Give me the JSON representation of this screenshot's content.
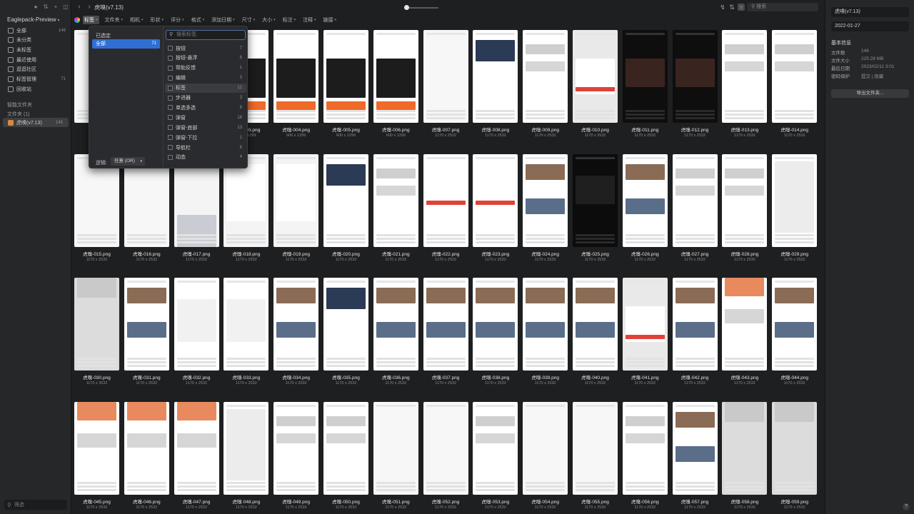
{
  "sidebar": {
    "library_title": "Eaglepack-Preview",
    "items": [
      {
        "label": "全部",
        "count": "146"
      },
      {
        "label": "未分类",
        "count": ""
      },
      {
        "label": "未标签",
        "count": ""
      },
      {
        "label": "最近使用",
        "count": ""
      },
      {
        "label": "逛逛社区",
        "count": ""
      },
      {
        "label": "标签管理",
        "count": "71"
      },
      {
        "label": "回收站",
        "count": ""
      }
    ],
    "smart_folders_label": "智能文件夹",
    "folders_label": "文件夹 (1)",
    "active_folder": {
      "label": "虎嗅(v7.13)",
      "count": "146"
    },
    "filter_placeholder": "筛选"
  },
  "toolbar": {
    "folder_title": "虎嗅(v7.13)",
    "search_placeholder": "搜索"
  },
  "filterbar": {
    "items": [
      "标签",
      "文件夹",
      "相机",
      "形状",
      "评分",
      "格式",
      "添加日期",
      "尺寸",
      "大小",
      "标注",
      "注释",
      "链接"
    ]
  },
  "tag_panel": {
    "selected_label": "已选定",
    "all_label": "全部",
    "all_count": "71",
    "search_placeholder": "搜索标签",
    "tags": [
      {
        "label": "按钮",
        "count": "7"
      },
      {
        "label": "按钮-悬浮",
        "count": "6"
      },
      {
        "label": "帮助反馈",
        "count": "1"
      },
      {
        "label": "编辑",
        "count": "3"
      },
      {
        "label": "标签",
        "count": "11"
      },
      {
        "label": "步进器",
        "count": "3"
      },
      {
        "label": "单选多选",
        "count": "8"
      },
      {
        "label": "弹窗",
        "count": "18"
      },
      {
        "label": "弹窗-底部",
        "count": "13"
      },
      {
        "label": "弹窗-下拉",
        "count": "1"
      },
      {
        "label": "导航栏",
        "count": "8"
      },
      {
        "label": "动态",
        "count": "4"
      }
    ],
    "logic_label": "逻辑:",
    "logic_value": "任意 (OR)"
  },
  "inspector": {
    "name_value": "虎嗅(v7.13)",
    "date_value": "2022-01-27",
    "heading": "基本信息",
    "rows": [
      {
        "label": "文件数",
        "value": "146"
      },
      {
        "label": "文件大小",
        "value": "225.28 MB"
      },
      {
        "label": "最后日期",
        "value": "2023/02/11 3:01"
      },
      {
        "label": "密码保护",
        "value": "提交 | 隐藏"
      }
    ],
    "export_label": "导出文件夹..."
  },
  "grid": {
    "items": [
      {
        "name": "",
        "dims": "",
        "theme": "white"
      },
      {
        "name": "",
        "dims": "",
        "theme": "white"
      },
      {
        "name": "虎嗅-003.png",
        "dims": "600 x 1299",
        "theme": "promo"
      },
      {
        "name": "虎嗅-003.png",
        "dims": "600 x 1299",
        "theme": "promo"
      },
      {
        "name": "虎嗅-004.png",
        "dims": "600 x 1299",
        "theme": "promo"
      },
      {
        "name": "虎嗅-005.png",
        "dims": "600 x 1299",
        "theme": "promo"
      },
      {
        "name": "虎嗅-006.png",
        "dims": "600 x 1299",
        "theme": "promo"
      },
      {
        "name": "虎嗅-007.png",
        "dims": "1170 x 2532",
        "theme": "white"
      },
      {
        "name": "虎嗅-008.png",
        "dims": "1170 x 2532",
        "theme": "article"
      },
      {
        "name": "虎嗅-009.png",
        "dims": "1170 x 2532",
        "theme": "list"
      },
      {
        "name": "虎嗅-010.png",
        "dims": "1170 x 2532",
        "theme": "modal"
      },
      {
        "name": "虎嗅-011.png",
        "dims": "1170 x 2532",
        "theme": "dark"
      },
      {
        "name": "虎嗅-012.png",
        "dims": "1170 x 2532",
        "theme": "dark"
      },
      {
        "name": "虎嗅-013.png",
        "dims": "1170 x 2532",
        "theme": "list"
      },
      {
        "name": "虎嗅-014.png",
        "dims": "1170 x 2532",
        "theme": "list"
      },
      {
        "name": "虎嗅-015.png",
        "dims": "1170 x 2532",
        "theme": "white"
      },
      {
        "name": "虎嗅-016.png",
        "dims": "1170 x 2532",
        "theme": "white"
      },
      {
        "name": "虎嗅-017.png",
        "dims": "1170 x 2532",
        "theme": "keyboard"
      },
      {
        "name": "虎嗅-018.png",
        "dims": "1170 x 2532",
        "theme": "settings"
      },
      {
        "name": "虎嗅-019.png",
        "dims": "1170 x 2532",
        "theme": "settings"
      },
      {
        "name": "虎嗅-020.png",
        "dims": "1170 x 2532",
        "theme": "article"
      },
      {
        "name": "虎嗅-021.png",
        "dims": "1170 x 2532",
        "theme": "list"
      },
      {
        "name": "虎嗅-022.png",
        "dims": "1170 x 2532",
        "theme": "form"
      },
      {
        "name": "虎嗅-023.png",
        "dims": "1170 x 2532",
        "theme": "form"
      },
      {
        "name": "虎嗅-024.png",
        "dims": "1170 x 2532",
        "theme": "feed"
      },
      {
        "name": "虎嗅-025.png",
        "dims": "1170 x 2532",
        "theme": "video"
      },
      {
        "name": "虎嗅-026.png",
        "dims": "1170 x 2532",
        "theme": "feed"
      },
      {
        "name": "虎嗅-027.png",
        "dims": "1170 x 2532",
        "theme": "list"
      },
      {
        "name": "虎嗅-028.png",
        "dims": "1170 x 2532",
        "theme": "list"
      },
      {
        "name": "虎嗅-029.png",
        "dims": "1170 x 2532",
        "theme": "text"
      },
      {
        "name": "虎嗅-030.png",
        "dims": "1170 x 2532",
        "theme": "grey"
      },
      {
        "name": "虎嗅-031.png",
        "dims": "1170 x 2532",
        "theme": "feed"
      },
      {
        "name": "虎嗅-032.png",
        "dims": "1170 x 2532",
        "theme": "calendar"
      },
      {
        "name": "虎嗅-033.png",
        "dims": "1170 x 2532",
        "theme": "calendar"
      },
      {
        "name": "虎嗅-034.png",
        "dims": "1170 x 2532",
        "theme": "feed"
      },
      {
        "name": "虎嗅-035.png",
        "dims": "1170 x 2532",
        "theme": "article"
      },
      {
        "name": "虎嗅-036.png",
        "dims": "1170 x 2532",
        "theme": "feed"
      },
      {
        "name": "虎嗅-037.png",
        "dims": "1170 x 2532",
        "theme": "feed"
      },
      {
        "name": "虎嗅-038.png",
        "dims": "1170 x 2532",
        "theme": "feed"
      },
      {
        "name": "虎嗅-039.png",
        "dims": "1170 x 2532",
        "theme": "feed"
      },
      {
        "name": "虎嗅-040.png",
        "dims": "1170 x 2532",
        "theme": "feed"
      },
      {
        "name": "虎嗅-041.png",
        "dims": "1170 x 2532",
        "theme": "modal"
      },
      {
        "name": "虎嗅-042.png",
        "dims": "1170 x 2532",
        "theme": "feed"
      },
      {
        "name": "虎嗅-043.png",
        "dims": "1170 x 2532",
        "theme": "orange"
      },
      {
        "name": "虎嗅-044.png",
        "dims": "1170 x 2532",
        "theme": "feed"
      },
      {
        "name": "虎嗅-045.png",
        "dims": "1170 x 2532",
        "theme": "orange"
      },
      {
        "name": "虎嗅-046.png",
        "dims": "1170 x 2532",
        "theme": "orange"
      },
      {
        "name": "虎嗅-047.png",
        "dims": "1170 x 2532",
        "theme": "orange"
      },
      {
        "name": "虎嗅-048.png",
        "dims": "1170 x 2532",
        "theme": "text"
      },
      {
        "name": "虎嗅-049.png",
        "dims": "1170 x 2532",
        "theme": "list"
      },
      {
        "name": "虎嗅-050.png",
        "dims": "1170 x 2532",
        "theme": "list"
      },
      {
        "name": "虎嗅-051.png",
        "dims": "1170 x 2532",
        "theme": "white"
      },
      {
        "name": "虎嗅-052.png",
        "dims": "1170 x 2532",
        "theme": "white"
      },
      {
        "name": "虎嗅-053.png",
        "dims": "1170 x 2532",
        "theme": "list"
      },
      {
        "name": "虎嗅-054.png",
        "dims": "1170 x 2532",
        "theme": "white"
      },
      {
        "name": "虎嗅-055.png",
        "dims": "1170 x 2532",
        "theme": "white"
      },
      {
        "name": "虎嗅-056.png",
        "dims": "1170 x 2532",
        "theme": "list"
      },
      {
        "name": "虎嗅-057.png",
        "dims": "1170 x 2532",
        "theme": "feed"
      },
      {
        "name": "虎嗅-058.png",
        "dims": "1170 x 2532",
        "theme": "grey"
      },
      {
        "name": "虎嗅-059.png",
        "dims": "1170 x 2532",
        "theme": "grey"
      }
    ]
  },
  "colors": {
    "accent": "#2f6fd3",
    "folder_icon": "#d68a3a",
    "background": "#1e1f21",
    "brand_red": "#e0423a"
  }
}
